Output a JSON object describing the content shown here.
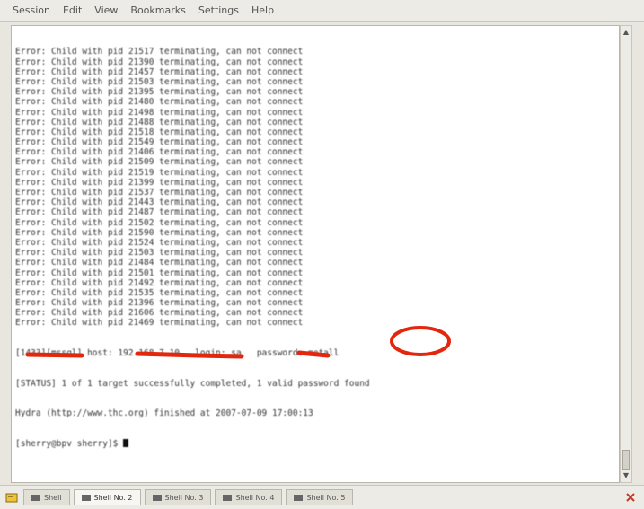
{
  "menubar": {
    "items": [
      "Session",
      "Edit",
      "View",
      "Bookmarks",
      "Settings",
      "Help"
    ]
  },
  "terminal": {
    "error_lines": [
      "Error: Child with pid 21517 terminating, can not connect",
      "Error: Child with pid 21390 terminating, can not connect",
      "Error: Child with pid 21457 terminating, can not connect",
      "Error: Child with pid 21503 terminating, can not connect",
      "Error: Child with pid 21395 terminating, can not connect",
      "Error: Child with pid 21480 terminating, can not connect",
      "Error: Child with pid 21498 terminating, can not connect",
      "Error: Child with pid 21488 terminating, can not connect",
      "Error: Child with pid 21518 terminating, can not connect",
      "Error: Child with pid 21549 terminating, can not connect",
      "Error: Child with pid 21406 terminating, can not connect",
      "Error: Child with pid 21509 terminating, can not connect",
      "Error: Child with pid 21519 terminating, can not connect",
      "Error: Child with pid 21399 terminating, can not connect",
      "Error: Child with pid 21537 terminating, can not connect",
      "Error: Child with pid 21443 terminating, can not connect",
      "Error: Child with pid 21487 terminating, can not connect",
      "Error: Child with pid 21502 terminating, can not connect",
      "Error: Child with pid 21590 terminating, can not connect",
      "Error: Child with pid 21524 terminating, can not connect",
      "Error: Child with pid 21503 terminating, can not connect",
      "Error: Child with pid 21484 terminating, can not connect",
      "Error: Child with pid 21501 terminating, can not connect",
      "Error: Child with pid 21492 terminating, can not connect",
      "Error: Child with pid 21535 terminating, can not connect",
      "Error: Child with pid 21396 terminating, can not connect",
      "Error: Child with pid 21606 terminating, can not connect",
      "Error: Child with pid 21469 terminating, can not connect"
    ],
    "result_line": "[1433][mssql] host: 192.168.7.10   login: sa   password: metall",
    "status_line": "[STATUS] 1 of 1 target successfully completed, 1 valid password found",
    "finish_line": "Hydra (http://www.thc.org) finished at 2007-07-09 17:00:13",
    "prompt": "[sherry@bpv sherry]$ "
  },
  "taskbar": {
    "tabs": [
      {
        "label": "Shell",
        "active": false
      },
      {
        "label": "Shell No. 2",
        "active": true
      },
      {
        "label": "Shell No. 3",
        "active": false
      },
      {
        "label": "Shell No. 4",
        "active": false
      },
      {
        "label": "Shell No. 5",
        "active": false
      }
    ]
  },
  "colors": {
    "annotation": "#e3270f",
    "terminal_bg": "#ffffff",
    "text": "#333333"
  },
  "icons": {
    "new_session": "new-session-icon",
    "close": "close-session-icon",
    "scroll_up": "scroll-up-icon",
    "scroll_down": "scroll-down-icon"
  }
}
